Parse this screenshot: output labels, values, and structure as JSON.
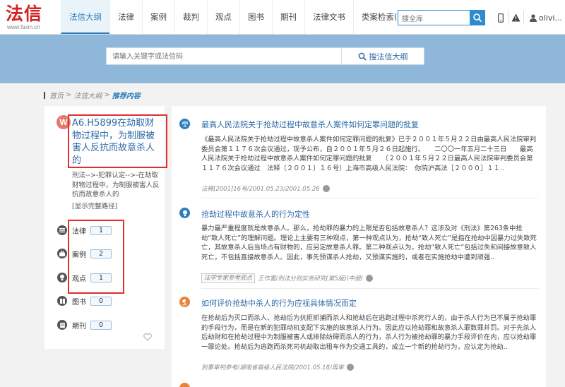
{
  "logo": {
    "main": "法信",
    "sub": "www.faxin.cn"
  },
  "nav": [
    "法信大纲",
    "法律",
    "案例",
    "裁判",
    "观点",
    "图书",
    "期刊",
    "法律文书",
    "类案检索(测试版)"
  ],
  "top_search": {
    "placeholder": "搜全库"
  },
  "user": {
    "name": "olivi..."
  },
  "banner": {
    "placeholder": "请输入关键字或法信码",
    "button_label": "搜法信大纲"
  },
  "breadcrumb": {
    "home": "首页",
    "sep": ">",
    "outline": "法信大纲",
    "current": "推荐内容"
  },
  "left": {
    "doc_icon": "W",
    "title": "A6.H5899在劫取财物过程中，为制服被害人反抗而故意杀人的",
    "path": "刑法-->-犯罪认定-->-在劫取财物过程中，为制服被害人反抗而故意杀人的",
    "show_path": "[显示完整路径]",
    "categories": [
      {
        "label": "法律",
        "count": "1",
        "icon": "law-icon"
      },
      {
        "label": "案例",
        "count": "2",
        "icon": "case-icon"
      },
      {
        "label": "观点",
        "count": "1",
        "icon": "viewpoint-icon"
      },
      {
        "label": "图书",
        "count": "0",
        "icon": "book-icon"
      },
      {
        "label": "期刊",
        "count": "0",
        "icon": "journal-icon"
      }
    ]
  },
  "articles": [
    {
      "title": "最高人民法院关于抢劫过程中故意杀人案件如何定罪问题的批复",
      "body": "《最高人民法院关于抢劫过程中故意杀人案件如何定罪问题的批复》已于２００１年５月２２日由最高人民法院审判委员会第１１７６次会议通过，现予公布，自２００１年５月２６日起施行。　　二〇〇一年五月二十三日　　最高人民法院关于抢劫过程中故意杀人案件如何定罪问题的批复　　（２００１年５月２２日最高人民法院审判委员会第１１７６次会议通过　法释〔２００１〕１６号）上海市高级人民法院：　你院沪高法［２０００］１１..",
      "meta": "法释[2001]16号/2001.05.23/2001.05.26",
      "icon": "scales-icon",
      "icon_color": "#2d7cba"
    },
    {
      "title": "抢劫过程中故意杀人的行为定性",
      "body": "暴力最严重程度就是故意杀人。那么，抢劫罪的暴力的上限是否包括故意杀人？这涉及对《刑法》第263条中抢劫“致人死亡”的理解问题。理论上主要有三种观点，第一种观点认为，抢劫“致人死亡”是指在抢劫中因暴力过失致死亡，其故意杀人后当场占有财物的，应另定故意杀人罪。第二种观点认为，抢劫“致人死亡”包括过失和间接故意致人死亡，不包括直接故意杀人。因此，事先预谋杀人抢劫，又预谋实施的，或者在实施抢劫中遭到顽强..",
      "tag": "法学专家参考观点",
      "meta": "王作富/刑法分则实务研究(第5版)(中册)",
      "icon": "lightbulb-icon",
      "icon_color": "#2d7cba"
    },
    {
      "title": "如何评价抢劫中杀人的行为应视具体情况而定",
      "body": "在抢劫后为灭口而杀人、抢劫后为抗拒抓捕而杀人和抢劫后在逃跑过程中杀死行人的，由于杀人行为已不属于抢劫罪的手段行为，而是在新的犯罪动机支配下实施的故意杀人行为。因此应以抢劫罪和故意杀人罪数罪并罚。对于先杀人后劫财和在抢劫过程中为制服被害人或排除妨碍而杀人的行为，杀人行为被抢劫罪的暴力手段评价在内，应以抢劫罪一罪论处。抢劫后为逃跑而杀死司机劫取出租车作为交通工具的，成立一个新的抢劫行为，应认定为抢劫..",
      "meta": "刑事审判参考/湖南省高级人民法院/2001.05.18/再审",
      "icon": "gavel-icon",
      "icon_color": "#e8823a"
    }
  ]
}
